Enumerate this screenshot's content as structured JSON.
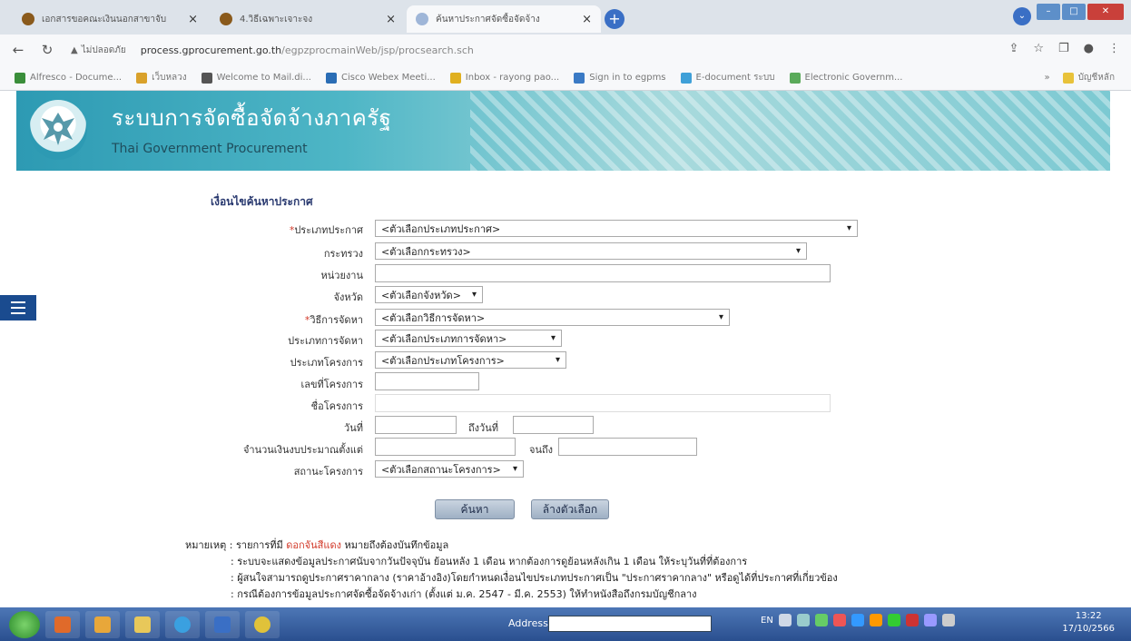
{
  "browser": {
    "tabs": [
      {
        "title": "เอกสารขอคณะเงินนอกสาขาจับ",
        "close": "×"
      },
      {
        "title": "4.วิธีเฉพาะเจาะจง",
        "close": "×"
      },
      {
        "title": "ค้นหาประกาศจัดซื้อจัดจ้าง",
        "close": "×"
      }
    ],
    "new_tab": "+",
    "insecure_label": "ไม่ปลอดภัย",
    "url_host": "process.gprocurement.go.th",
    "url_path": "/egpzprocmainWeb/jsp/procsearch.sch",
    "bookmarks": [
      {
        "label": "Alfresco - Docume...",
        "color": "#3a8e3a"
      },
      {
        "label": "เว็บหลวง",
        "color": "#d9a12b"
      },
      {
        "label": "Welcome to Mail.di...",
        "color": "#555555"
      },
      {
        "label": "Cisco Webex Meeti...",
        "color": "#2a6db5"
      },
      {
        "label": "Inbox - rayong pao...",
        "color": "#e0b020"
      },
      {
        "label": "Sign in to egpms",
        "color": "#3a7ac5"
      },
      {
        "label": "E-document ระบบ",
        "color": "#3fa0d8"
      },
      {
        "label": "Electronic Governm...",
        "color": "#5aaa5a"
      }
    ],
    "bookmarks_more": "»",
    "bookmark_folder": "บัญชีหลัก"
  },
  "banner": {
    "title": "ระบบการจัดซื้อจัดจ้างภาครัฐ",
    "subtitle": "Thai Government Procurement"
  },
  "form": {
    "heading": "เงื่อนไขค้นหาประกาศ",
    "announce_type_label": "ประเภทประกาศ",
    "announce_type_value": "<ตัวเลือกประเภทประกาศ>",
    "ministry_label": "กระทรวง",
    "ministry_value": "<ตัวเลือกกระทรวง>",
    "agency_label": "หน่วยงาน",
    "province_label": "จังหวัด",
    "province_value": "<ตัวเลือกจังหวัด>",
    "method_label": "วิธีการจัดหา",
    "method_value": "<ตัวเลือกวิธีการจัดหา>",
    "procure_type_label": "ประเภทการจัดหา",
    "procure_type_value": "<ตัวเลือกประเภทการจัดหา>",
    "project_type_label": "ประเภทโครงการ",
    "project_type_value": "<ตัวเลือกประเภทโครงการ>",
    "project_no_label": "เลขที่โครงการ",
    "project_name_label": "ชื่อโครงการ",
    "date_label": "วันที่",
    "date_to_label": "ถึงวันที่",
    "budget_label": "จำนวนเงินงบประมาณตั้งแต่",
    "budget_to_label": "จนถึง",
    "status_label": "สถานะโครงการ",
    "status_value": "<ตัวเลือกสถานะโครงการ>",
    "search_button": "ค้นหา",
    "clear_button": "ล้างตัวเลือก"
  },
  "notes": {
    "prefix": "หมายเหตุ : รายการที่มี",
    "red_text": "ดอกจันสีแดง",
    "suffix": "หมายถึงต้องบันทึกข้อมูล",
    "line1": ": ระบบจะแสดงข้อมูลประกาศนับจากวันปัจจุบัน ย้อนหลัง 1 เดือน หากต้องการดูย้อนหลังเกิน 1 เดือน ให้ระบุวันที่ที่ต้องการ",
    "line2": ": ผู้สนใจสามารถดูประกาศราคากลาง (ราคาอ้างอิง)โดยกำหนดเงื่อนไขประเภทประกาศเป็น \"ประกาศราคากลาง\" หรือดูได้ที่ประกาศที่เกี่ยวข้อง",
    "line3": ": กรณีต้องการข้อมูลประกาศจัดซื้อจัดจ้างเก่า (ตั้งแต่ ม.ค. 2547 - มี.ค. 2553) ให้ทำหนังสือถึงกรมบัญชีกลาง"
  },
  "taskbar": {
    "address_label": "Address",
    "lang": "EN",
    "time": "13:22",
    "date": "17/10/2566"
  }
}
